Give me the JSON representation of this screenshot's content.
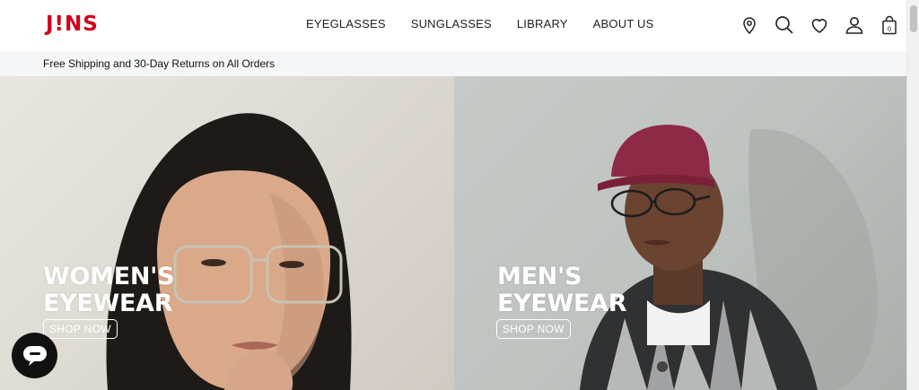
{
  "brand": {
    "logo": "J!NS",
    "accent_color": "#d0021b"
  },
  "nav": {
    "items": [
      {
        "label": "EYEGLASSES"
      },
      {
        "label": "SUNGLASSES"
      },
      {
        "label": "LIBRARY"
      },
      {
        "label": "ABOUT US"
      }
    ]
  },
  "header_icons": [
    "location-pin-icon",
    "search-icon",
    "heart-icon",
    "user-icon",
    "shopping-bag-icon"
  ],
  "cart": {
    "count": "0"
  },
  "promo": {
    "text": "Free Shipping and 30-Day Returns on All Orders"
  },
  "heroes": [
    {
      "title_line1": "WOMEN'S",
      "title_line2": "EYEWEAR",
      "cta": "SHOP NOW"
    },
    {
      "title_line1": "MEN'S",
      "title_line2": "EYEWEAR",
      "cta": "SHOP NOW"
    }
  ],
  "chat": {
    "icon": "chat-bubble-icon"
  }
}
